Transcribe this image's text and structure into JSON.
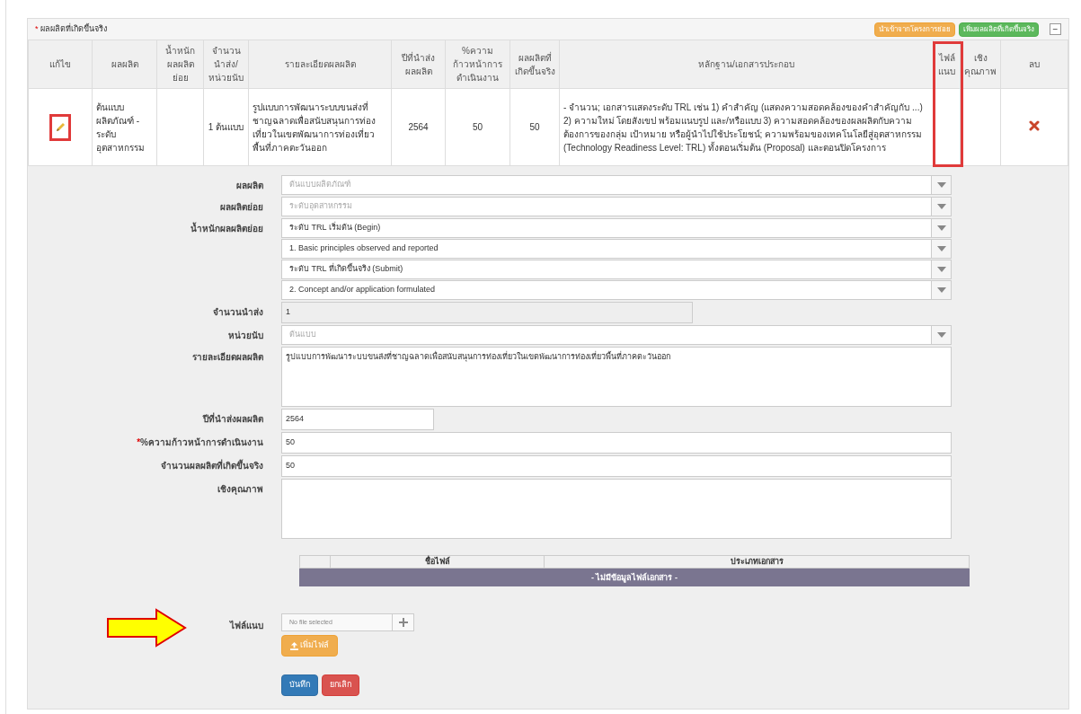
{
  "panel": {
    "title": "ผลผลิตที่เกิดขึ้นจริง",
    "marker": "*",
    "buttons": [
      {
        "label": "นำเข้าจากโครงการย่อย",
        "kind": "warning"
      },
      {
        "label": "เพิ่มผลผลิตที่เกิดขึ้นจริง",
        "kind": "success"
      }
    ],
    "collapse": "−"
  },
  "table": {
    "columns": [
      "แก้ไข",
      "ผลผลิต",
      "น้ำหนักผลผลิตย่อย",
      "จำนวนนำส่ง/หน่วยนับ",
      "รายละเอียดผลผลิต",
      "ปีที่นำส่งผลผลิต",
      "%ความก้าวหน้าการดำเนินงาน",
      "ผลผลิตที่เกิดขึ้นจริง",
      "หลักฐาน/เอกสารประกอบ",
      "ไฟล์แนบ",
      "เชิงคุณภาพ",
      "ลบ"
    ],
    "rows": [
      {
        "product": "ต้นแบบผลิตภัณฑ์ - ระดับอุตสาหกรรม",
        "amount": "1 ต้นแบบ",
        "detail": "รูปแบบการพัฒนาระบบขนส่งที่ชาญฉลาดเพื่อสนับสนุนการท่องเที่ยวในเขตพัฒนาการท่องเที่ยวพื้นที่ภาคตะวันออก",
        "year": "2564",
        "progress": "50",
        "actual": "50",
        "evidence": "- จำนวน; เอกสารแสดงระดับ TRL เช่น 1) คำสำคัญ (แสดงความสอดคล้องของคำสำคัญกับ ...) 2) ความใหม่ โดยสังเขป พร้อมแนบรูป และ/หรือแบบ 3) ความสอดคล้องของผลผลิตกับความต้องการของกลุ่ม เป้าหมาย หรือผู้นำไปใช้ประโยชน์; ความพร้อมของเทคโนโลยีสู่อุตสาหกรรม (Technology Readiness Level: TRL) ทั้งตอนเริ่มต้น (Proposal) และตอนปิดโครงการ"
      }
    ]
  },
  "form": {
    "fields": [
      {
        "label": "ผลผลิต",
        "controls": [
          {
            "kind": "select",
            "value": "ต้นแบบผลิตภัณฑ์",
            "disabled": true
          }
        ]
      },
      {
        "label": "ผลผลิตย่อย",
        "controls": [
          {
            "kind": "select",
            "value": "ระดับอุตสาหกรรม",
            "disabled": true
          }
        ]
      },
      {
        "label": "น้ำหนักผลผลิตย่อย",
        "controls": [
          {
            "kind": "select",
            "value": "ระดับ TRL เริ่มต้น (Begin)",
            "disabled": false
          },
          {
            "kind": "select",
            "value": "1. Basic principles observed and reported",
            "disabled": false
          },
          {
            "kind": "select",
            "value": "ระดับ TRL ที่เกิดขึ้นจริง (Submit)",
            "disabled": false
          },
          {
            "kind": "select",
            "value": "2. Concept and/or application formulated",
            "disabled": false
          }
        ]
      },
      {
        "label": "จำนวนนำส่ง",
        "controls": [
          {
            "kind": "medium-input",
            "value": "1",
            "disabled": true
          }
        ]
      },
      {
        "label": "หน่วยนับ",
        "controls": [
          {
            "kind": "select",
            "value": "ต้นแบบ",
            "disabled": true
          }
        ]
      },
      {
        "label": "รายละเอียดผลผลิต",
        "controls": [
          {
            "kind": "textarea",
            "value": "รูปแบบการพัฒนาระบบขนส่งที่ชาญฉลาดเพื่อสนับสนุนการท่องเที่ยวในเขตพัฒนาการท่องเที่ยวพื้นที่ภาคตะวันออก",
            "disabled": false
          }
        ]
      },
      {
        "label": "ปีที่นำส่งผลผลิต",
        "controls": [
          {
            "kind": "short-input",
            "value": "2564",
            "disabled": false
          }
        ]
      },
      {
        "label": "%ความก้าวหน้าการดำเนินงาน",
        "marker": "*",
        "controls": [
          {
            "kind": "input",
            "value": "50",
            "disabled": false
          }
        ]
      },
      {
        "label": "จำนวนผลผลิตที่เกิดขึ้นจริง",
        "controls": [
          {
            "kind": "input",
            "value": "50",
            "disabled": false
          }
        ]
      },
      {
        "label": "เชิงคุณภาพ",
        "controls": [
          {
            "kind": "textarea",
            "disabled": false
          }
        ]
      }
    ],
    "files": {
      "columns": [
        "ชื่อไฟล์",
        "ประเภทเอกสาร"
      ],
      "empty": "- ไม่มีข้อมูลไฟล์เอกสาร -"
    },
    "attach": {
      "label": "ไฟล์แนบ",
      "placeholder": "No file selected",
      "add_button": "เพิ่มไฟล์"
    },
    "buttons": [
      {
        "label": "บันทึก",
        "kind": "primary"
      },
      {
        "label": "ยกเลิก",
        "kind": "danger"
      }
    ]
  }
}
